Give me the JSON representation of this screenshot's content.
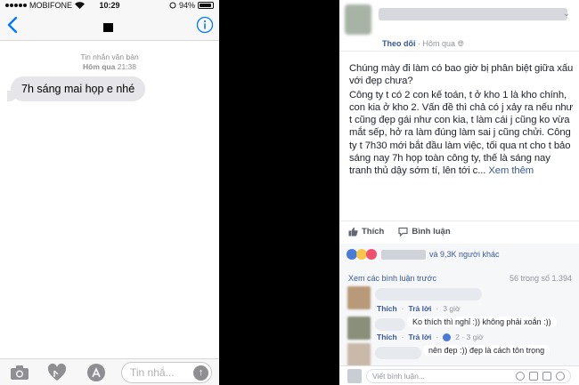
{
  "messages_app": {
    "status_bar": {
      "carrier": "MOBIFONE",
      "time": "10:29",
      "battery": "94%",
      "battery_level": 0.94
    },
    "thread_meta": {
      "label": "Tin nhắn văn bản",
      "day": "Hôm qua",
      "time": "21:38"
    },
    "message": "7h sáng mai họp e nhé",
    "input_placeholder": "Tin nhắ..."
  },
  "facebook_post": {
    "follow_label": "Theo dõi",
    "time_label": "Hôm qua",
    "paragraphs": [
      "Chúng mày đi làm có bao giờ bị phân biệt giữa xấu với đẹp chưa?",
      "Công ty t có 2 con kế toán, t ở kho 1 là kho chính, con kia ở kho 2. Vấn đề thì chả có j xảy ra nếu như t cũng đẹp gái như con kia, t làm cái j cũng ko vừa mắt sếp, hở ra làm đúng làm sai j cũng chửi. Công ty t 7h30 mới bắt đầu làm việc, tối qua nt cho t bảo sáng nay 7h họp toàn công ty, thế là sáng nay tranh thủ dậy sớm tí, lên tới c..."
    ],
    "see_more": "Xem thêm",
    "like_label": "Thích",
    "comment_label": "Bình luận",
    "reaction_summary": "và 9,3K người khác",
    "view_previous": "Xem các bình luận trước",
    "comment_count": "56 trong số 1.394",
    "comments": [
      {
        "text": "",
        "like": "Thích",
        "reply": "Trả lời",
        "time": "3 giờ",
        "likes": ""
      },
      {
        "text": "Ko thích thì nghỉ :)) không phải xoắn :))",
        "like": "Thích",
        "reply": "Trả lời",
        "time": "2 · 3 giờ",
        "likes": ""
      },
      {
        "text": "nên đẹp :)) đẹp là cách tôn trọng",
        "like": "",
        "reply": "",
        "time": "",
        "likes": ""
      }
    ],
    "write_placeholder": "Viết bình luận..."
  }
}
